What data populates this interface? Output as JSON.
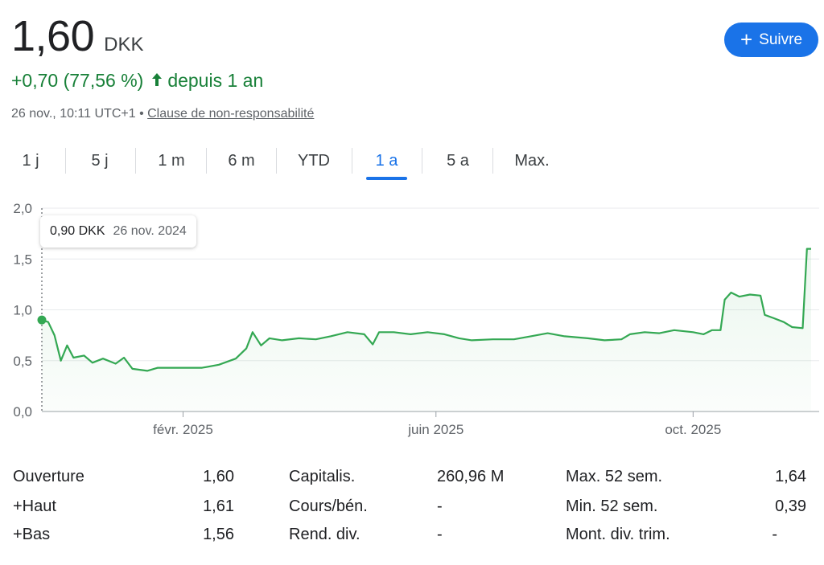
{
  "header": {
    "price": "1,60",
    "currency": "DKK",
    "follow_label": "Suivre",
    "change_text": "+0,70 (77,56 %)",
    "period_text": "depuis 1 an",
    "timestamp": "26 nov., 10:11 UTC+1",
    "separator": "•",
    "disclaimer": "Clause de non-responsabilité"
  },
  "tabs": [
    {
      "label": "1 j",
      "active": false
    },
    {
      "label": "5 j",
      "active": false
    },
    {
      "label": "1 m",
      "active": false
    },
    {
      "label": "6 m",
      "active": false
    },
    {
      "label": "YTD",
      "active": false
    },
    {
      "label": "1 a",
      "active": true
    },
    {
      "label": "5 a",
      "active": false
    },
    {
      "label": "Max.",
      "active": false
    }
  ],
  "tooltip": {
    "price": "0,90 DKK",
    "date": "26 nov. 2024"
  },
  "colors": {
    "accent": "#1a73e8",
    "positive": "#188038",
    "line": "#34a853"
  },
  "chart_data": {
    "type": "area",
    "x_start": "2024-11-26",
    "x_end": "2025-11-26",
    "ylim": [
      0,
      2
    ],
    "yticks": [
      "0,0",
      "0,5",
      "1,0",
      "1,5",
      "2,0"
    ],
    "xticks": [
      {
        "label": "févr. 2025",
        "date": "2025-02-01"
      },
      {
        "label": "juin 2025",
        "date": "2025-06-01"
      },
      {
        "label": "oct. 2025",
        "date": "2025-10-01"
      }
    ],
    "series": [
      {
        "points": [
          [
            "2024-11-26",
            0.9
          ],
          [
            "2024-11-29",
            0.88
          ],
          [
            "2024-12-02",
            0.75
          ],
          [
            "2024-12-05",
            0.5
          ],
          [
            "2024-12-08",
            0.65
          ],
          [
            "2024-12-11",
            0.53
          ],
          [
            "2024-12-16",
            0.55
          ],
          [
            "2024-12-20",
            0.48
          ],
          [
            "2024-12-25",
            0.52
          ],
          [
            "2024-12-31",
            0.47
          ],
          [
            "2025-01-04",
            0.53
          ],
          [
            "2025-01-08",
            0.42
          ],
          [
            "2025-01-15",
            0.4
          ],
          [
            "2025-01-20",
            0.43
          ],
          [
            "2025-01-30",
            0.43
          ],
          [
            "2025-02-10",
            0.43
          ],
          [
            "2025-02-18",
            0.46
          ],
          [
            "2025-02-26",
            0.52
          ],
          [
            "2025-03-03",
            0.62
          ],
          [
            "2025-03-06",
            0.78
          ],
          [
            "2025-03-10",
            0.65
          ],
          [
            "2025-03-14",
            0.72
          ],
          [
            "2025-03-20",
            0.7
          ],
          [
            "2025-03-28",
            0.72
          ],
          [
            "2025-04-05",
            0.71
          ],
          [
            "2025-04-12",
            0.74
          ],
          [
            "2025-04-20",
            0.78
          ],
          [
            "2025-04-28",
            0.76
          ],
          [
            "2025-05-02",
            0.66
          ],
          [
            "2025-05-05",
            0.78
          ],
          [
            "2025-05-12",
            0.78
          ],
          [
            "2025-05-20",
            0.76
          ],
          [
            "2025-05-28",
            0.78
          ],
          [
            "2025-06-05",
            0.76
          ],
          [
            "2025-06-12",
            0.72
          ],
          [
            "2025-06-18",
            0.7
          ],
          [
            "2025-06-28",
            0.71
          ],
          [
            "2025-07-08",
            0.71
          ],
          [
            "2025-07-16",
            0.74
          ],
          [
            "2025-07-24",
            0.77
          ],
          [
            "2025-08-01",
            0.74
          ],
          [
            "2025-08-12",
            0.72
          ],
          [
            "2025-08-20",
            0.7
          ],
          [
            "2025-08-28",
            0.71
          ],
          [
            "2025-09-01",
            0.76
          ],
          [
            "2025-09-08",
            0.78
          ],
          [
            "2025-09-15",
            0.77
          ],
          [
            "2025-09-22",
            0.8
          ],
          [
            "2025-10-01",
            0.78
          ],
          [
            "2025-10-06",
            0.76
          ],
          [
            "2025-10-10",
            0.8
          ],
          [
            "2025-10-14",
            0.8
          ],
          [
            "2025-10-16",
            1.1
          ],
          [
            "2025-10-19",
            1.17
          ],
          [
            "2025-10-23",
            1.13
          ],
          [
            "2025-10-28",
            1.15
          ],
          [
            "2025-11-02",
            1.14
          ],
          [
            "2025-11-04",
            0.95
          ],
          [
            "2025-11-08",
            0.92
          ],
          [
            "2025-11-13",
            0.88
          ],
          [
            "2025-11-17",
            0.83
          ],
          [
            "2025-11-22",
            0.82
          ],
          [
            "2025-11-24",
            1.6
          ],
          [
            "2025-11-26",
            1.6
          ]
        ]
      }
    ]
  },
  "stats": [
    [
      {
        "label": "Ouverture",
        "value": "1,60"
      },
      {
        "label": "Capitalis.",
        "value": "260,96 M"
      },
      {
        "label": "Max. 52 sem.",
        "value": "1,64"
      }
    ],
    [
      {
        "label": "+Haut",
        "value": "1,61"
      },
      {
        "label": "Cours/bén.",
        "value": "-"
      },
      {
        "label": "Min. 52 sem.",
        "value": "0,39"
      }
    ],
    [
      {
        "label": "+Bas",
        "value": "1,56"
      },
      {
        "label": "Rend. div.",
        "value": "-"
      },
      {
        "label": "Mont. div. trim.",
        "value": "-"
      }
    ]
  ]
}
